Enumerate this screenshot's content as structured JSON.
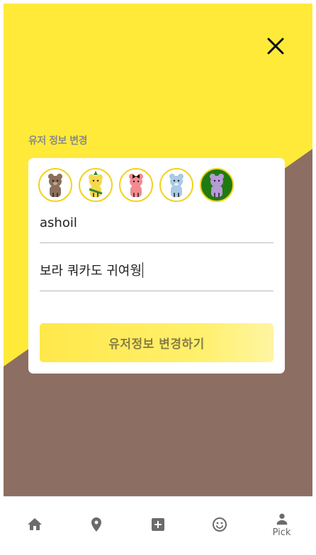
{
  "header": {
    "close_icon": "close-icon"
  },
  "form": {
    "section_title": "유저 정보 변경",
    "avatars": [
      {
        "name": "brown-bear",
        "color": "#8b6f5c"
      },
      {
        "name": "yellow-bear",
        "color": "#f6d84c"
      },
      {
        "name": "pink-bear",
        "color": "#f28a8f"
      },
      {
        "name": "blue-bear",
        "color": "#a9c9e6"
      },
      {
        "name": "purple-bear",
        "color": "#b79ad6",
        "selected": true
      }
    ],
    "username_value": "ashoil",
    "status_value": "보라 쿼카도 귀여웡",
    "submit_label": "유저정보 변경하기"
  },
  "bottom_nav": {
    "items": [
      {
        "icon": "home-icon"
      },
      {
        "icon": "location-pin-icon"
      },
      {
        "icon": "add-box-icon"
      },
      {
        "icon": "smiley-icon"
      },
      {
        "icon": "person-icon",
        "label": "Pick",
        "active": true
      }
    ]
  },
  "colors": {
    "yellow": "#ffea3a",
    "brown": "#8d6e63",
    "avatar_border": "#f3d21e",
    "selected_avatar_bg": "#1f7a12",
    "button_text": "#8a7d45"
  }
}
